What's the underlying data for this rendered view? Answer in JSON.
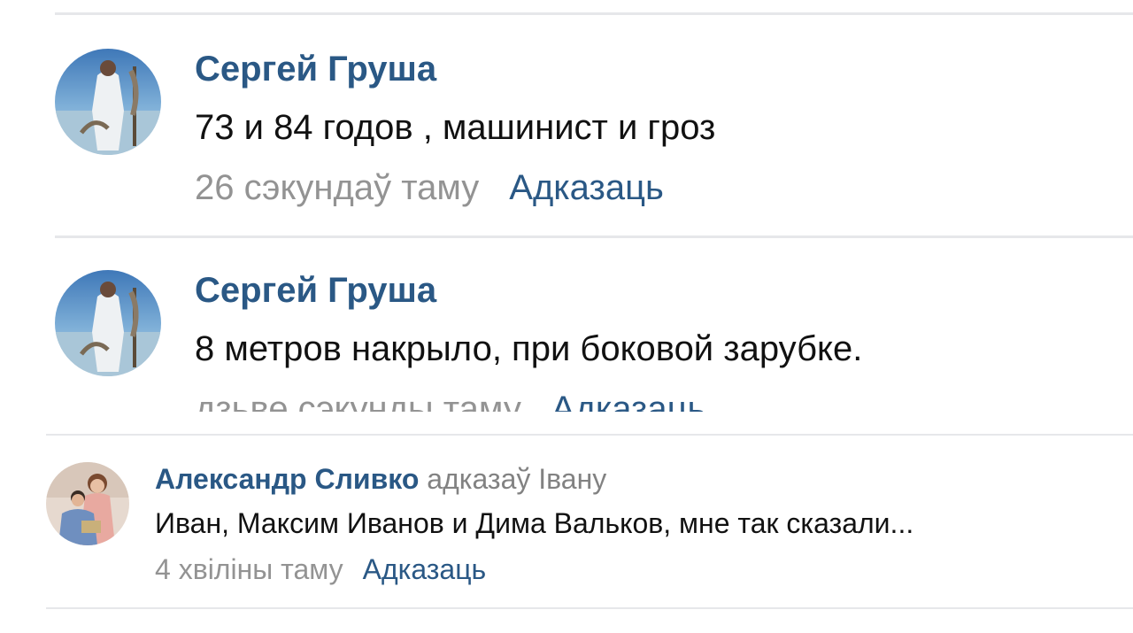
{
  "comments": [
    {
      "author": "Сергей Груша",
      "text": "73 и 84 годов , машинист и гроз",
      "time": "26 сэкундаў таму",
      "reply": "Адказаць",
      "avatar_icon": "fisherman-avatar"
    },
    {
      "author": "Сергей Груша",
      "text": "8 метров накрыло, при боковой зарубке.",
      "time": "дзьве сэкунды таму",
      "reply": "Адказаць",
      "avatar_icon": "fisherman-avatar"
    },
    {
      "author": "Александр Сливко",
      "replied_to": "адказаў Івану",
      "text": "Иван, Максим Иванов и Дима Вальков, мне так сказали...",
      "time": "4 хвіліны таму",
      "reply": "Адказаць",
      "avatar_icon": "couple-avatar"
    }
  ],
  "colors": {
    "link": "#2a5885",
    "muted": "#939393",
    "text": "#111111",
    "divider": "#e6e7ea"
  }
}
